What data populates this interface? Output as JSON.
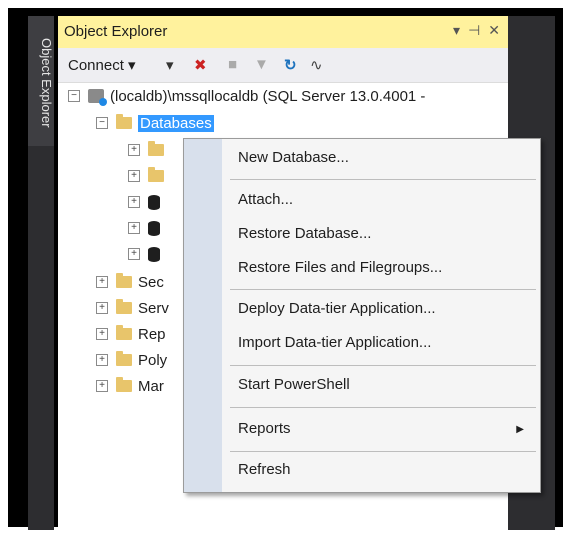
{
  "side_tab": {
    "label": "Object Explorer"
  },
  "panel": {
    "title": "Object Explorer",
    "pin_glyphs": "▾  ⊣  ✕"
  },
  "toolbar": {
    "connect_label": "Connect ▾"
  },
  "tree": {
    "server_label": "(localdb)\\mssqllocaldb (SQL Server 13.0.4001 -",
    "databases_label": "Databases",
    "children": [
      {
        "label": "Sec"
      },
      {
        "label": "Serv"
      },
      {
        "label": "Rep"
      },
      {
        "label": "Poly"
      },
      {
        "label": "Mar"
      }
    ]
  },
  "context_menu": {
    "items": [
      "New Database...",
      "Attach...",
      "Restore Database...",
      "Restore Files and Filegroups...",
      "Deploy Data-tier Application...",
      "Import Data-tier Application...",
      "Start PowerShell",
      "Reports",
      "Refresh"
    ]
  }
}
